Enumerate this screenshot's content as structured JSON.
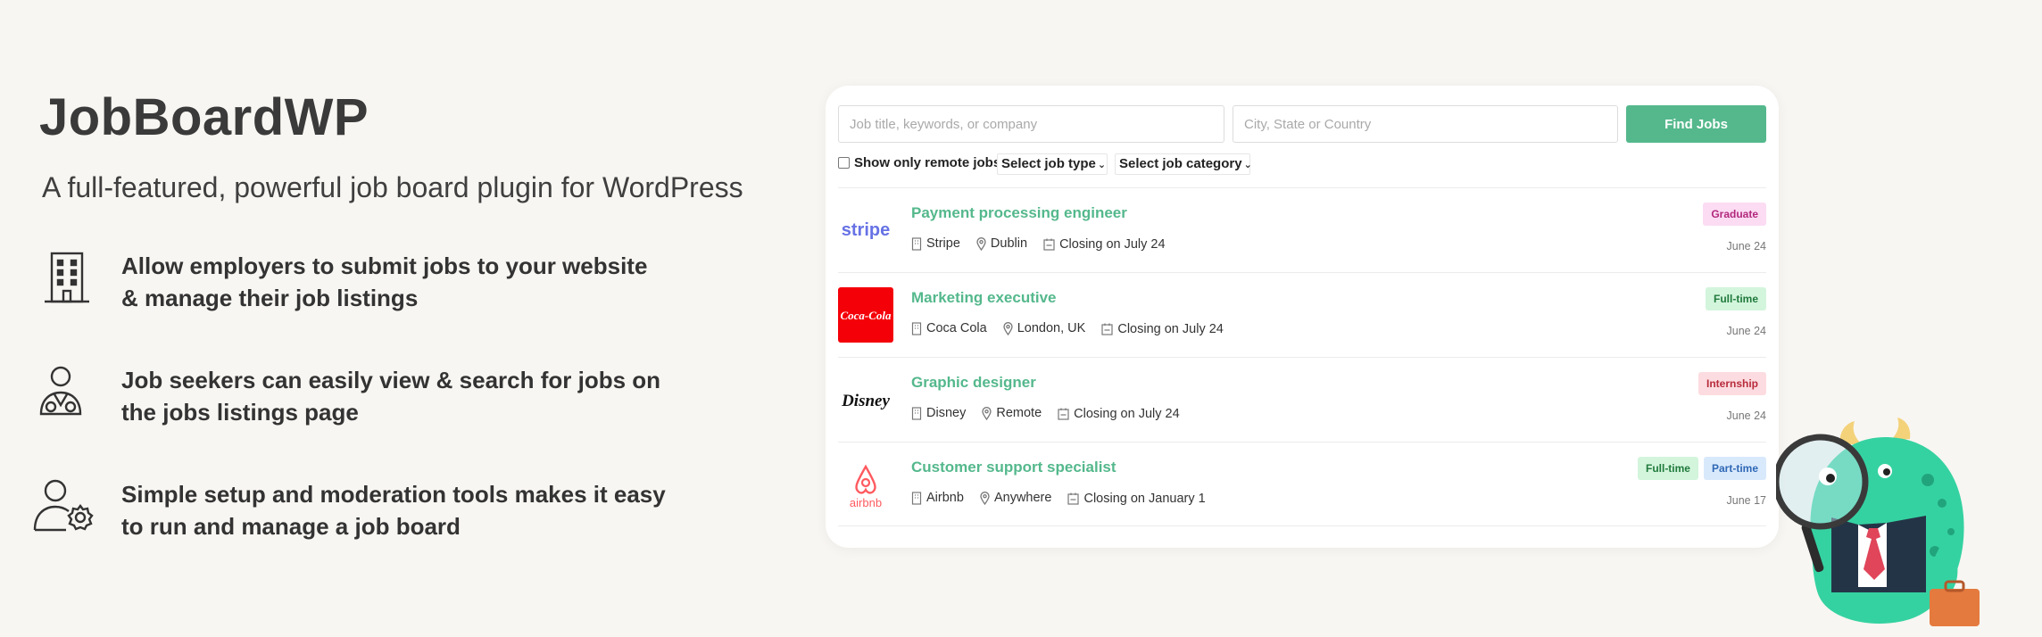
{
  "brand": {
    "title": "JobBoardWP",
    "subtitle": "A full-featured, powerful job board plugin for WordPress"
  },
  "features": [
    {
      "icon": "building-icon",
      "line1": "Allow employers to submit jobs to your website",
      "line2": "& manage their job listings"
    },
    {
      "icon": "job-seeker-icon",
      "line1": "Job seekers can easily view & search for jobs on",
      "line2": "the jobs listings page"
    },
    {
      "icon": "user-settings-icon",
      "line1": "Simple setup and moderation tools makes it easy",
      "line2": "to run and manage a job board"
    }
  ],
  "search": {
    "keywords_placeholder": "Job title, keywords, or company",
    "location_placeholder": "City, State or Country",
    "button_label": "Find Jobs",
    "remote_label": "Show only remote jobs",
    "job_type_label": "Select job type",
    "job_category_label": "Select job category"
  },
  "colors": {
    "accent": "#54b88c",
    "background": "#f8f6f2"
  },
  "jobs": [
    {
      "title": "Payment processing engineer",
      "company": "Stripe",
      "location": "Dublin",
      "closing": "Closing on July 24",
      "date": "June 24",
      "logo_text": "stripe",
      "badges": [
        {
          "label": "Graduate",
          "bg": "#fbdcf3",
          "fg": "#b3287d"
        }
      ]
    },
    {
      "title": "Marketing executive",
      "company": "Coca Cola",
      "location": "London, UK",
      "closing": "Closing on July 24",
      "date": "June 24",
      "logo_text": "Coca-Cola",
      "badges": [
        {
          "label": "Full-time",
          "bg": "#d3f5dc",
          "fg": "#207a3c"
        }
      ]
    },
    {
      "title": "Graphic designer",
      "company": "Disney",
      "location": "Remote",
      "closing": "Closing on July 24",
      "date": "June 24",
      "logo_text": "Disney",
      "badges": [
        {
          "label": "Internship",
          "bg": "#fcdce0",
          "fg": "#b82b3c"
        }
      ]
    },
    {
      "title": "Customer support specialist",
      "company": "Airbnb",
      "location": "Anywhere",
      "closing": "Closing on January 1",
      "date": "June 17",
      "logo_text": "airbnb",
      "badges": [
        {
          "label": "Full-time",
          "bg": "#d3f5dc",
          "fg": "#207a3c"
        },
        {
          "label": "Part-time",
          "bg": "#d9e9fc",
          "fg": "#2f68b5"
        }
      ]
    }
  ]
}
